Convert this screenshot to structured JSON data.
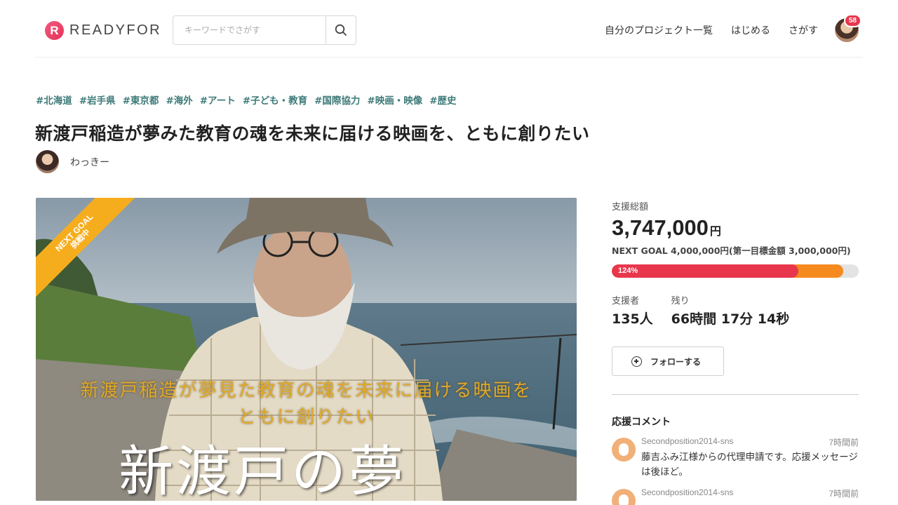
{
  "header": {
    "logo_mark": "R",
    "logo_text": "READYFOR",
    "search_placeholder": "キーワードでさがす",
    "nav": [
      "自分のプロジェクト一覧",
      "はじめる",
      "さがす"
    ],
    "notification_count": "58"
  },
  "project": {
    "tags": [
      "#北海道",
      "#岩手県",
      "#東京都",
      "#海外",
      "#アート",
      "#子ども・教育",
      "#国際協力",
      "#映画・映像",
      "#歴史"
    ],
    "title": "新渡戸稲造が夢みた教育の魂を未来に届ける映画を、ともに創りたい",
    "owner_name": "わっきー"
  },
  "hero": {
    "ribbon_line1": "NEXT GOAL",
    "ribbon_line2": "挑戦中",
    "caption_line1": "新渡戸稲造が夢見た教育の魂を未来に届ける映画を",
    "caption_line2": "ともに創りたい",
    "caption_big": "新渡戸の夢"
  },
  "funding": {
    "total_label": "支援総額",
    "amount": "3,747,000",
    "currency": "円",
    "goal_text": "NEXT GOAL 4,000,000円(第一目標金額 3,000,000円)",
    "progress_label": "124%",
    "progress_first_goal_fraction": 1.0,
    "progress_next_goal_fraction": 0.937,
    "supporters_label": "支援者",
    "supporters_value": "135人",
    "remaining_label": "残り",
    "remaining_value": "66時間 17分 14秒",
    "follow_label": "フォローする"
  },
  "comments": {
    "title": "応援コメント",
    "items": [
      {
        "user": "Secondposition2014-sns",
        "time": "7時間前",
        "text": "藤吉ふみ江様からの代理申請です。応援メッセージは後ほど。"
      },
      {
        "user": "Secondposition2014-sns",
        "time": "7時間前",
        "text": ""
      }
    ]
  },
  "colors": {
    "accent_red": "#e8374d",
    "accent_orange": "#f58a1f",
    "tag_teal": "#3d7a78",
    "ribbon_yellow": "#f6ad1d"
  }
}
